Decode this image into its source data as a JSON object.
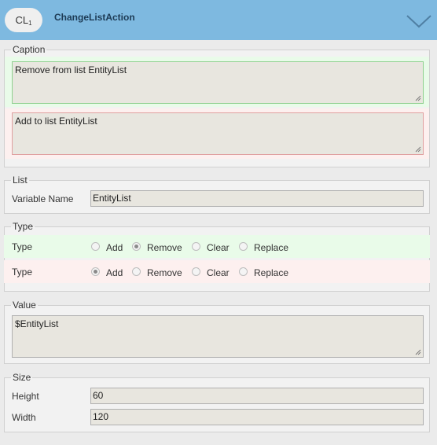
{
  "header": {
    "badge_main": "CL",
    "badge_sub": "1",
    "title": "ChangeListAction"
  },
  "caption": {
    "legend": "Caption",
    "new_value": "Remove from list EntityList",
    "old_value": "Add to list EntityList"
  },
  "list": {
    "legend": "List",
    "variable_label": "Variable Name",
    "variable_value": "EntityList"
  },
  "type": {
    "legend": "Type",
    "rows": [
      {
        "label": "Type",
        "selected": "Remove",
        "state": "new"
      },
      {
        "label": "Type",
        "selected": "Add",
        "state": "old"
      }
    ],
    "options": [
      "Add",
      "Remove",
      "Clear",
      "Replace"
    ]
  },
  "value": {
    "legend": "Value",
    "text": "$EntityList"
  },
  "size": {
    "legend": "Size",
    "height_label": "Height",
    "height_value": "60",
    "width_label": "Width",
    "width_value": "120"
  },
  "colors": {
    "header_bg": "#7eb9e0",
    "new_border": "#8fd08f",
    "old_border": "#e0a0a0"
  }
}
